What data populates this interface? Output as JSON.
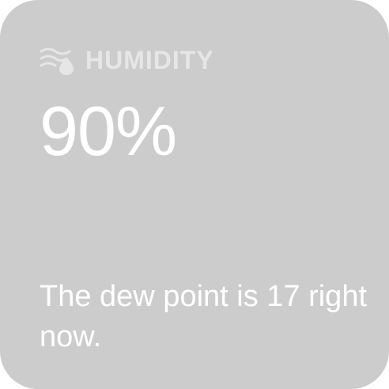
{
  "widget": {
    "icon": "humidity-icon",
    "title": "HUMIDITY",
    "value": "90%",
    "description": "The dew point is 17 right now."
  },
  "colors": {
    "card_background": "#cccccc",
    "text": "#ffffff",
    "header_text": "#e6e6e6"
  }
}
